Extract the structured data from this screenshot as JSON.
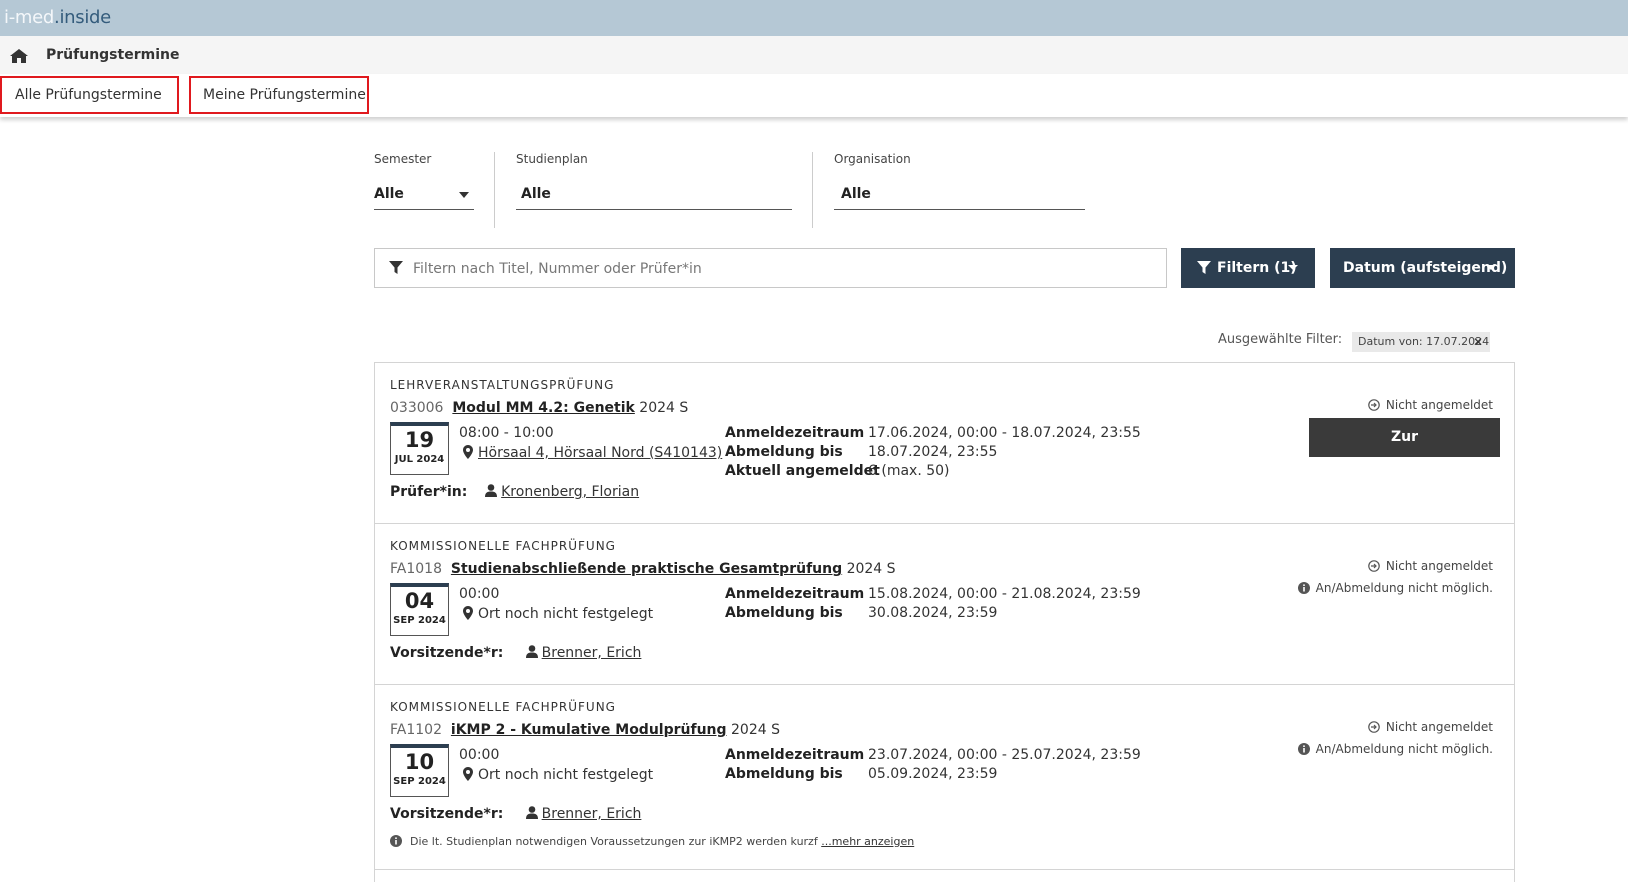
{
  "app": {
    "logo_part1": "i-med",
    "logo_part2": ".inside"
  },
  "breadcrumb": {
    "title": "Prüfungstermine"
  },
  "tabs": [
    {
      "label": "Alle Prüfungstermine"
    },
    {
      "label": "Meine Prüfungstermine"
    }
  ],
  "filters": {
    "semester": {
      "label": "Semester",
      "value": "Alle"
    },
    "studienplan": {
      "label": "Studienplan",
      "value": "Alle"
    },
    "organisation": {
      "label": "Organisation",
      "value": "Alle"
    }
  },
  "search": {
    "placeholder": "Filtern nach Titel, Nummer oder Prüfer*in",
    "value": ""
  },
  "buttons": {
    "filter_label": "Filtern (1)",
    "sort_label": "Datum (aufsteigend)"
  },
  "selected_filters": {
    "label": "Ausgewählte Filter:",
    "chip": "Datum von: 17.07.2024"
  },
  "exams": [
    {
      "type": "LEHRVERANSTALTUNGSPRÜFUNG",
      "number": "033006",
      "title": "Modul MM 4.2: Genetik",
      "semester": "2024 S",
      "day": "19",
      "month_year": "JUL 2024",
      "time": "08:00 - 10:00",
      "location": "Hörsaal 4, Hörsaal Nord (S410143)",
      "person_label": "Prüfer*in:",
      "person": "Kronenberg, Florian",
      "details": [
        {
          "key": "Anmeldezeitraum",
          "value": "17.06.2024, 00:00 - 18.07.2024, 23:55"
        },
        {
          "key": "Abmeldung bis",
          "value": "18.07.2024, 23:55"
        },
        {
          "key": "Aktuell angemeldet",
          "value": "6 (max. 50)"
        }
      ],
      "status": "Nicht angemeldet",
      "action_label": "Zur Prüfungsanmeldung"
    },
    {
      "type": "KOMMISSIONELLE FACHPRÜFUNG",
      "number": "FA1018",
      "title": "Studienabschließende praktische Gesamtprüfung",
      "semester": "2024 S",
      "day": "04",
      "month_year": "SEP 2024",
      "time": "00:00",
      "location": "Ort noch nicht festgelegt",
      "person_label": "Vorsitzende*r:",
      "person": "Brenner, Erich",
      "details": [
        {
          "key": "Anmeldezeitraum",
          "value": "15.08.2024, 00:00 - 21.08.2024, 23:59"
        },
        {
          "key": "Abmeldung bis",
          "value": "30.08.2024, 23:59"
        }
      ],
      "status": "Nicht angemeldet",
      "info": "An/Abmeldung nicht möglich."
    },
    {
      "type": "KOMMISSIONELLE FACHPRÜFUNG",
      "number": "FA1102",
      "title": "iKMP 2 - Kumulative Modulprüfung",
      "semester": "2024 S",
      "day": "10",
      "month_year": "SEP 2024",
      "time": "00:00",
      "location": "Ort noch nicht festgelegt",
      "person_label": "Vorsitzende*r:",
      "person": "Brenner, Erich",
      "details": [
        {
          "key": "Anmeldezeitraum",
          "value": "23.07.2024, 00:00 - 25.07.2024, 23:59"
        },
        {
          "key": "Abmeldung bis",
          "value": "05.09.2024, 23:59"
        }
      ],
      "status": "Nicht angemeldet",
      "info": "An/Abmeldung nicht möglich.",
      "note": "Die lt. Studienplan notwendigen Voraussetzungen zur iKMP2 werden kurzf",
      "note_more": "...mehr anzeigen"
    }
  ],
  "colors": {
    "header_bg": "#b5c8d5",
    "dark_button": "#2c3e50",
    "tab_outline": "#e0191e"
  }
}
